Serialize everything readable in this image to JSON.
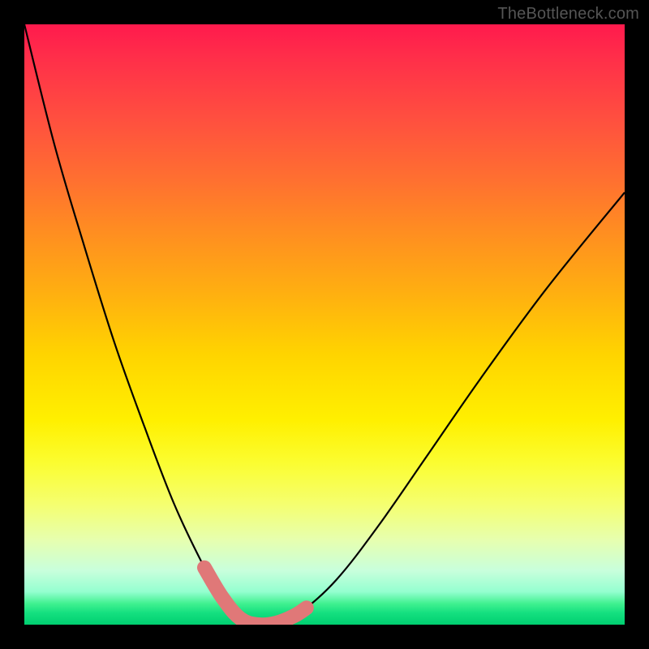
{
  "watermark": {
    "text": "TheBottleneck.com"
  },
  "colors": {
    "frame": "#000000",
    "curve": "#000000",
    "highlight": "#e07878",
    "gradient_stops": [
      "#ff1a4d",
      "#ff3049",
      "#ff503f",
      "#ff7030",
      "#ff8f20",
      "#ffb010",
      "#ffd400",
      "#fff000",
      "#fbfd30",
      "#f5ff70",
      "#e6ffb0",
      "#c8ffdc",
      "#95ffd0",
      "#40f190",
      "#15e080",
      "#00cf70"
    ]
  },
  "chart_data": {
    "type": "line",
    "title": "",
    "xlabel": "",
    "ylabel": "",
    "xlim": [
      0,
      1
    ],
    "ylim": [
      0,
      1
    ],
    "notes": "Bottleneck curve. x runs from left component to right component; y is mismatch percentage (0 at bottom/green = balanced, 1 at top/red = 100% bottleneck). Minimum sits slightly left of center.",
    "series": [
      {
        "name": "bottleneck-curve",
        "x": [
          0.0,
          0.05,
          0.1,
          0.15,
          0.2,
          0.25,
          0.3,
          0.335,
          0.37,
          0.4,
          0.43,
          0.46,
          0.52,
          0.59,
          0.67,
          0.76,
          0.87,
          1.0
        ],
        "values": [
          1.0,
          0.8,
          0.63,
          0.47,
          0.33,
          0.2,
          0.095,
          0.035,
          0.003,
          0.0,
          0.003,
          0.02,
          0.075,
          0.165,
          0.28,
          0.41,
          0.56,
          0.72
        ]
      }
    ],
    "highlight_segment": {
      "description": "thick salmon overlay near the minimum",
      "x": [
        0.3,
        0.33,
        0.36,
        0.39,
        0.42,
        0.45,
        0.47
      ],
      "values": [
        0.095,
        0.045,
        0.01,
        0.0,
        0.003,
        0.015,
        0.028
      ]
    }
  }
}
